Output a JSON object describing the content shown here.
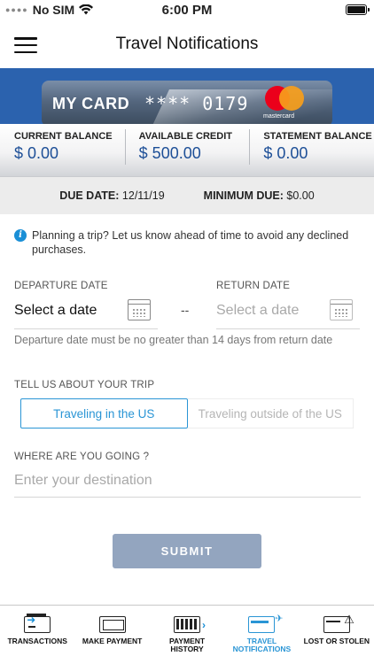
{
  "status_bar": {
    "carrier": "No SIM",
    "time": "6:00 PM"
  },
  "header": {
    "title": "Travel Notifications"
  },
  "card": {
    "name": "MY CARD",
    "number": "**** 0179",
    "network": "mastercard"
  },
  "balances": [
    {
      "label": "CURRENT BALANCE",
      "value": "$ 0.00"
    },
    {
      "label": "AVAILABLE CREDIT",
      "value": "$ 500.00"
    },
    {
      "label": "STATEMENT BALANCE",
      "value": "$ 0.00"
    }
  ],
  "due": {
    "due_date_label": "DUE DATE:",
    "due_date_value": "12/11/19",
    "minimum_due_label": "MINIMUM DUE:",
    "minimum_due_value": "$0.00"
  },
  "info_text": "Planning a trip? Let us know ahead of time to avoid any declined purchases.",
  "departure": {
    "label": "DEPARTURE DATE",
    "value": "Select a date"
  },
  "date_separator": "--",
  "return": {
    "label": "RETURN DATE",
    "placeholder": "Select a date"
  },
  "hint": "Departure date must be no greater than 14 days from return date",
  "trip": {
    "label": "TELL US ABOUT YOUR TRIP",
    "options": [
      "Traveling in the US",
      "Traveling outside of the US"
    ],
    "selected": "Traveling in the US"
  },
  "destination": {
    "label": "WHERE ARE YOU GOING ?",
    "placeholder": "Enter your destination"
  },
  "submit_label": "SUBMIT",
  "colors": {
    "accent": "#2a95d5",
    "brand_blue": "#2b62ae",
    "button": "#93a5bf"
  },
  "nav": [
    {
      "label": "TRANSACTIONS",
      "icon": "transactions-icon"
    },
    {
      "label": "MAKE PAYMENT",
      "icon": "payment-icon"
    },
    {
      "label": "PAYMENT HISTORY",
      "icon": "payment-history-icon"
    },
    {
      "label": "TRAVEL NOTIFICATIONS",
      "icon": "travel-icon",
      "active": true
    },
    {
      "label": "LOST OR STOLEN",
      "icon": "lost-stolen-icon"
    }
  ]
}
